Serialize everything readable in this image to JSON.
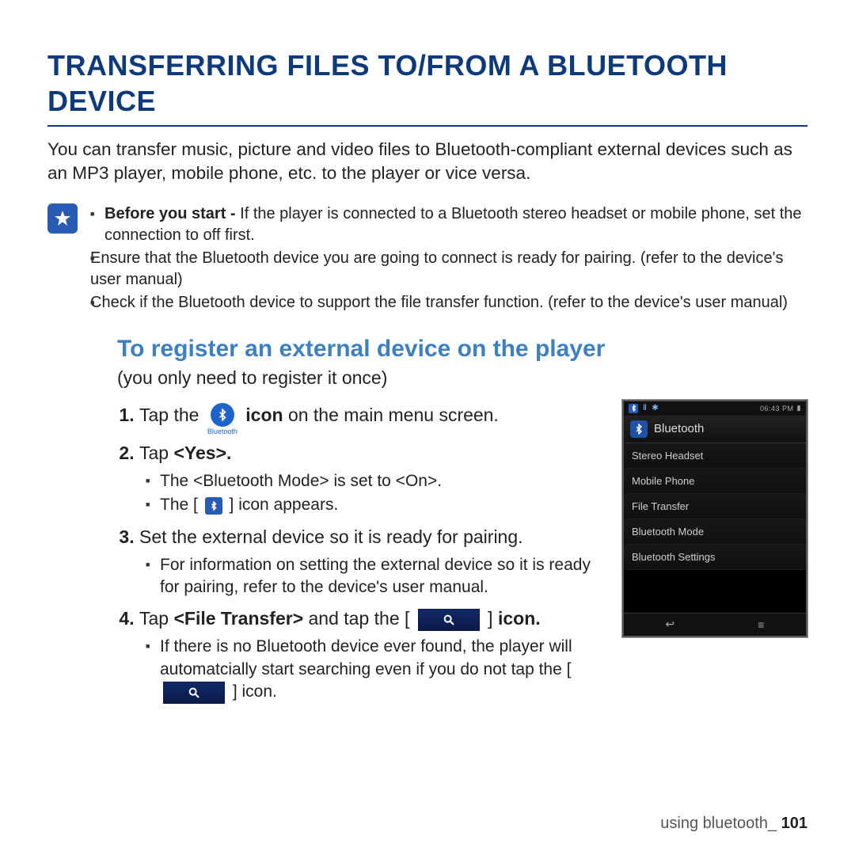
{
  "title": "TRANSFERRING FILES TO/FROM A BLUETOOTH DEVICE",
  "intro": "You can transfer music, picture and video files to Bluetooth-compliant external devices such as an MP3 player, mobile phone, etc. to the player or vice versa.",
  "note": {
    "bullets": [
      {
        "lead": "Before you start - ",
        "text": "If the player is connected to a Bluetooth stereo headset or mobile phone, set the connection to off first."
      },
      {
        "lead": "",
        "text": "Ensure that the Bluetooth device you are going to connect is ready for pairing. (refer to the device's user manual)"
      },
      {
        "lead": "",
        "text": "Check if the Bluetooth device to support the file transfer function. (refer to the device's user manual)"
      }
    ]
  },
  "subtitle": "To register an external device on the player",
  "reg_only": "(you only need to register it once)",
  "steps": {
    "s1": {
      "pre": "Tap the ",
      "mid_bold": "icon",
      "post": " on the main menu screen.",
      "chip_label": "Bluetooth"
    },
    "s2": {
      "pre": "Tap ",
      "bold": "<Yes>.",
      "sub": [
        "The <Bluetooth Mode> is set to <On>.",
        "The [ {BTSQ} ] icon appears."
      ]
    },
    "s3": {
      "text": "Set the external device so it is ready for pairing.",
      "sub": [
        "For information on setting the external device so it is ready for pairing, refer to the device's user manual."
      ]
    },
    "s4": {
      "pre": "Tap ",
      "bold1": "<File Transfer>",
      "mid": " and tap the [ ",
      "post": " ] ",
      "bold2": "icon.",
      "sub": [
        "If there is no Bluetooth device ever found, the player will automatcially start searching even if you do not tap the [ {SEARCH} ] icon."
      ]
    }
  },
  "device": {
    "status_time": "06:43 PM",
    "header": "Bluetooth",
    "menu": [
      "Stereo Headset",
      "Mobile Phone",
      "File Transfer",
      "Bluetooth Mode",
      "Bluetooth Settings"
    ]
  },
  "footer": {
    "section": "using bluetooth_ ",
    "page": "101"
  }
}
